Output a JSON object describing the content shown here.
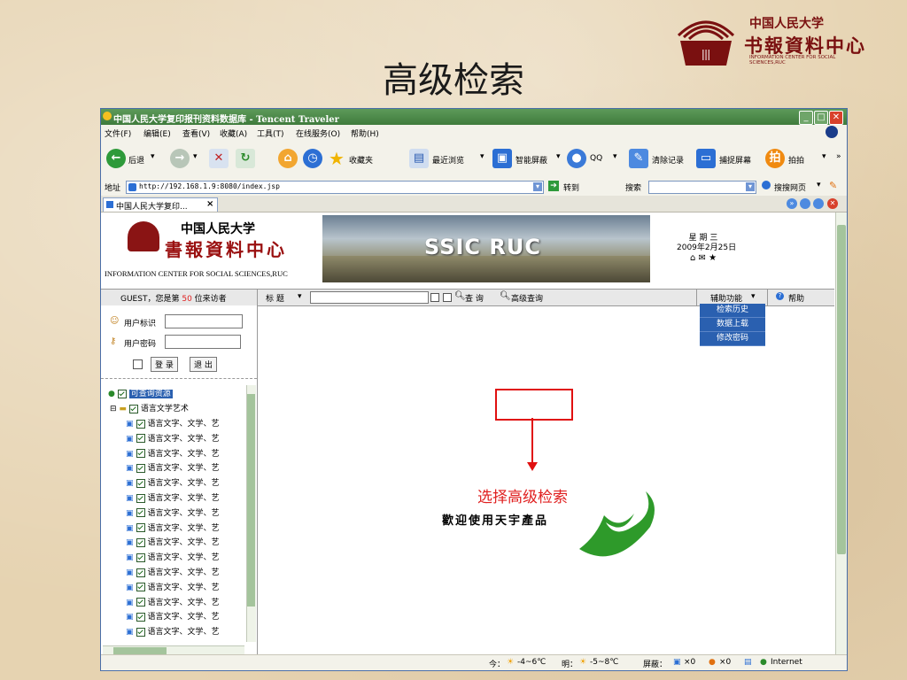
{
  "slide": {
    "title": "高级检索",
    "logo_line1": "中国人民大学",
    "logo_line2": "书報資料中心",
    "logo_line3": "INFORMATION CENTER FOR SOCIAL SCIENCES,RUC"
  },
  "window": {
    "title": "中国人民大学复印报刊资料数据库 - Tencent Traveler",
    "menu": [
      "文件(F)",
      "编辑(E)",
      "查看(V)",
      "收藏(A)",
      "工具(T)",
      "在线服务(O)",
      "帮助(H)"
    ],
    "toolbar": {
      "back": "后退",
      "favorites": "收藏夹",
      "recent": "最近浏览",
      "smart_block": "智能屏蔽",
      "qq": "QQ",
      "clear_records": "清除记录",
      "capture_screen": "捕捉屏幕",
      "paipai": "拍拍",
      "more": "»"
    },
    "address_label": "地址",
    "address_value": "http://192.168.1.9:8080/index.jsp",
    "go_label": "转到",
    "search_label": "搜索",
    "search_web": "搜搜网页",
    "tab_label": "中国人民大学复印...",
    "status": {
      "today": "今：",
      "today_temp": "-4~6℃",
      "tomorrow": "明：",
      "tomorrow_temp": "-5~8℃",
      "block_label": "屏蔽：",
      "count1": "×0",
      "count2": "×0",
      "zone": "Internet"
    }
  },
  "site": {
    "logo_line1": "中国人民大学",
    "logo_line2": "書報資料中心",
    "logo_line3": "INFORMATION CENTER FOR SOCIAL SCIENCES,RUC",
    "banner_text": "SSIC RUC",
    "weekday": "星 期 三",
    "date": "2009年2月25日",
    "visitor_prefix": "GUEST，您是第",
    "visitor_count": "50",
    "visitor_suffix": "位来访者",
    "search_field": "标 题",
    "query_button": "查 询",
    "advanced_search": "高级查询",
    "aux_functions": "辅助功能",
    "help": "帮助",
    "aux_menu": [
      "检索历史",
      "数据上载",
      "修改密码"
    ],
    "user_id_label": "用户标识",
    "password_label": "用户密码",
    "login": "登 录",
    "logout": "退 出",
    "tree_root": "可查询资源",
    "tree_category": "语言文学艺术",
    "tree_item": "语言文字、文学、艺",
    "callout": "选择高级检索",
    "welcome": "歡迎使用天宇產品"
  },
  "colors": {
    "highlight": "#e01010",
    "titlebar": "#4a8a46",
    "menu_blue": "#2a60b0",
    "slide_title": "#1a1a1a",
    "logo_red": "#7a1010"
  }
}
